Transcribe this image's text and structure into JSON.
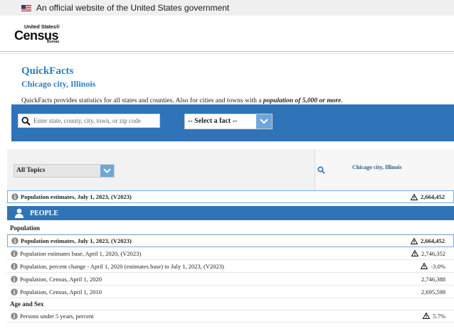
{
  "gov_banner": {
    "text": "An official website of the United States government"
  },
  "logo": {
    "top": "United States®",
    "main": "Census",
    "bottom": "Bureau"
  },
  "intro": {
    "title": "QuickFacts",
    "subtitle": "Chicago city, Illinois",
    "description_prefix": "QuickFacts provides statistics for all states and counties. Also for cities and towns with a ",
    "description_emphasis": "population of 5,000 or more",
    "description_suffix": "."
  },
  "search": {
    "placeholder": "Enter state, county, city, town, or zip code",
    "fact_select_label": "-- Select a fact --"
  },
  "table": {
    "topics_label": "All Topics",
    "place_column": "Chicago city, Illinois",
    "summary_row": {
      "label": "Population estimates, July 1, 2023, (V2023)",
      "value": "2,664,452"
    },
    "people_band": "PEOPLE",
    "sections": [
      {
        "title": "Population",
        "rows": [
          {
            "label": "Population estimates, July 1, 2023, (V2023)",
            "value": "2,664,452"
          },
          {
            "label": "Population estimates base, April 1, 2020, (V2023)",
            "value": "2,746,352"
          },
          {
            "label": "Population, percent change - April 1, 2020 (estimates base) to July 1, 2023, (V2023)",
            "value": "-3.0%"
          },
          {
            "label": "Population, Census, April 1, 2020",
            "value": "2,746,388"
          },
          {
            "label": "Population, Census, April 1, 2010",
            "value": "2,695,598"
          }
        ]
      },
      {
        "title": "Age and Sex",
        "rows": [
          {
            "label": "Persons under 5 years, percent",
            "value": "5.7%"
          }
        ]
      }
    ]
  },
  "colors": {
    "brand_blue": "#2f74b9",
    "title_blue": "#2f7dbd",
    "dropdown_blue": "#6fa6d8"
  }
}
